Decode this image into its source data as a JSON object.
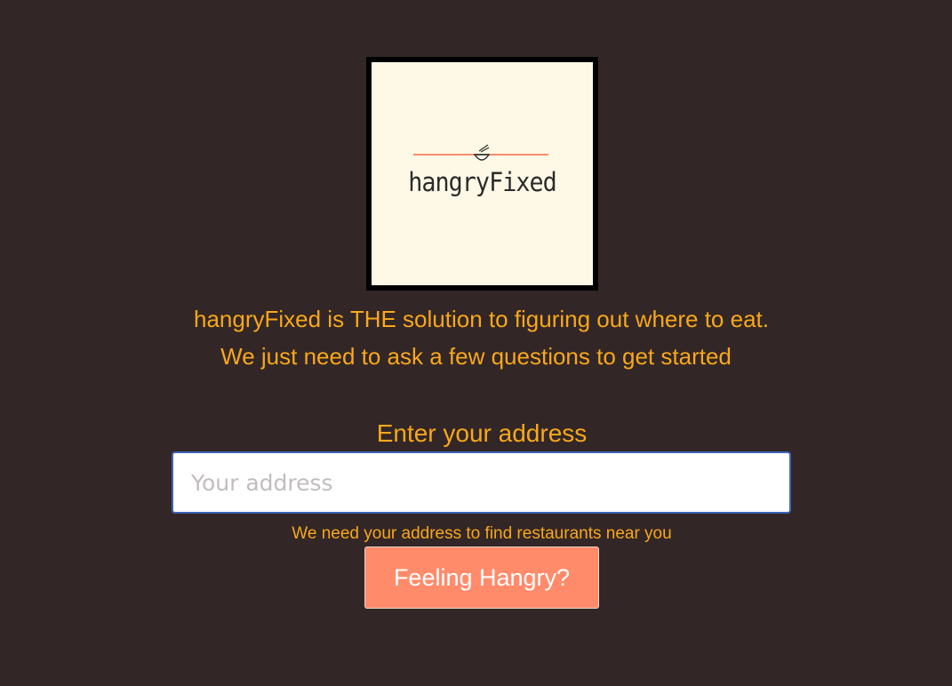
{
  "logo": {
    "wordmark": "hangryFixed",
    "icon": "bowl-with-chopsticks-icon",
    "background_color": "#fdf9e6",
    "line_color": "#ff8b6b"
  },
  "intro": {
    "line1": "hangryFixed is THE solution to figuring out where to eat.",
    "line2": "We just need to ask a few questions to get started"
  },
  "address": {
    "label": "Enter your address",
    "placeholder": "Your address",
    "value": "",
    "help_text": "We need your address to find restaurants near you"
  },
  "submit": {
    "label": "Feeling Hangry?"
  },
  "colors": {
    "background": "#332627",
    "accent_text": "#f7a81b",
    "button": "#ff8b6b"
  }
}
